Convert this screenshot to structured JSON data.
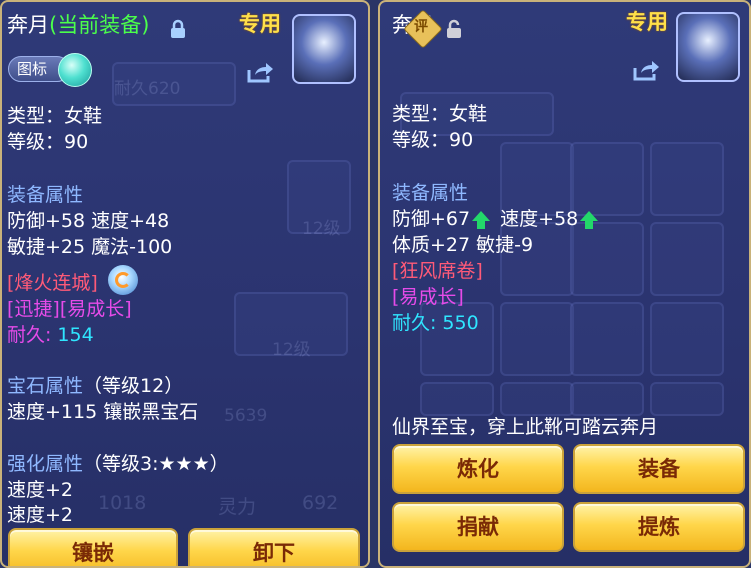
{
  "left": {
    "name": "奔月",
    "current_tag": "(当前装备)",
    "special": "专用",
    "badge": "图标",
    "type": "类型：女鞋",
    "level": "等级：90",
    "attr_title": "装备属性",
    "attr_line1": "防御+58 速度+48",
    "attr_line2": "敏捷+25 魔法-100",
    "skill1": "[烽火连城]",
    "skill2": "[迅捷][易成长]",
    "durability_label": "耐久:",
    "durability_value": "154",
    "gem_title": "宝石属性",
    "gem_level": "（等级12）",
    "gem_line": "速度+115 镶嵌黑宝石",
    "enh_title": "强化属性",
    "enh_level": "（等级3:★★★）",
    "enh_line1": "速度+2",
    "enh_line2": "速度+2",
    "btn1": "镶嵌",
    "btn2": "卸下"
  },
  "right": {
    "name": "奔月",
    "pin": "评",
    "special": "专用",
    "type": "类型：女鞋",
    "level": "等级：90",
    "attr_title": "装备属性",
    "attr_def": "防御+67",
    "attr_spd": "速度+58",
    "attr_line2": "体质+27 敏捷-9",
    "skill1": "[狂风席卷]",
    "skill2": "[易成长]",
    "durability_label": "耐久:",
    "durability_value": "550",
    "desc": "仙界至宝，穿上此靴可踏云奔月",
    "btn_refine": "炼化",
    "btn_equip": "装备",
    "btn_donate": "捐献",
    "btn_extract": "提炼"
  },
  "background": {
    "ghost_level": "12级",
    "ghost_durability": "耐久620",
    "ghost_stat_left": "1018",
    "ghost_spirit": "灵力",
    "ghost_stat_right": "692",
    "ghost_num": "5639"
  }
}
